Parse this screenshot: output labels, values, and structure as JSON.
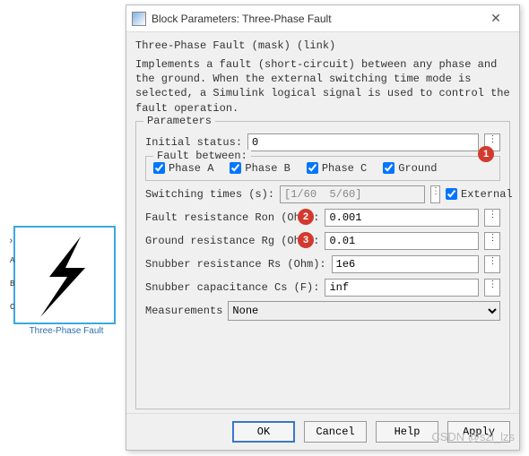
{
  "block": {
    "caption": "Three-Phase Fault",
    "ports": [
      "A",
      "B",
      "C"
    ]
  },
  "dialog": {
    "title": "Block Parameters: Three-Phase Fault",
    "mask_title": "Three-Phase Fault (mask) (link)",
    "description": "Implements a fault (short-circuit) between any phase and the ground. When the external switching time mode is selected, a Simulink logical signal is used to control the fault operation.",
    "parameters_legend": "Parameters",
    "initial_status_label": "Initial status:",
    "initial_status_value": "0",
    "fault_between_legend": "Fault between:",
    "phase_a": "Phase A",
    "phase_b": "Phase B",
    "phase_c": "Phase C",
    "ground": "Ground",
    "switching_times_label": "Switching times (s):",
    "switching_times_value": "[1/60  5/60]",
    "external_label": "External",
    "fault_res_label": "Fault resistance Ron (Ohm):",
    "fault_res_value": "0.001",
    "ground_res_label": "Ground resistance Rg (Ohm):",
    "ground_res_value": "0.01",
    "snubber_res_label": "Snubber resistance Rs (Ohm):",
    "snubber_res_value": "1e6",
    "snubber_cap_label": "Snubber capacitance Cs (F):",
    "snubber_cap_value": "inf",
    "measurements_label": "Measurements",
    "measurements_value": "None",
    "btn_ok": "OK",
    "btn_cancel": "Cancel",
    "btn_help": "Help",
    "btn_apply": "Apply"
  },
  "annotations": {
    "b1": "1",
    "b2": "2",
    "b3": "3"
  },
  "watermark": "CSDN @szl_lzs"
}
